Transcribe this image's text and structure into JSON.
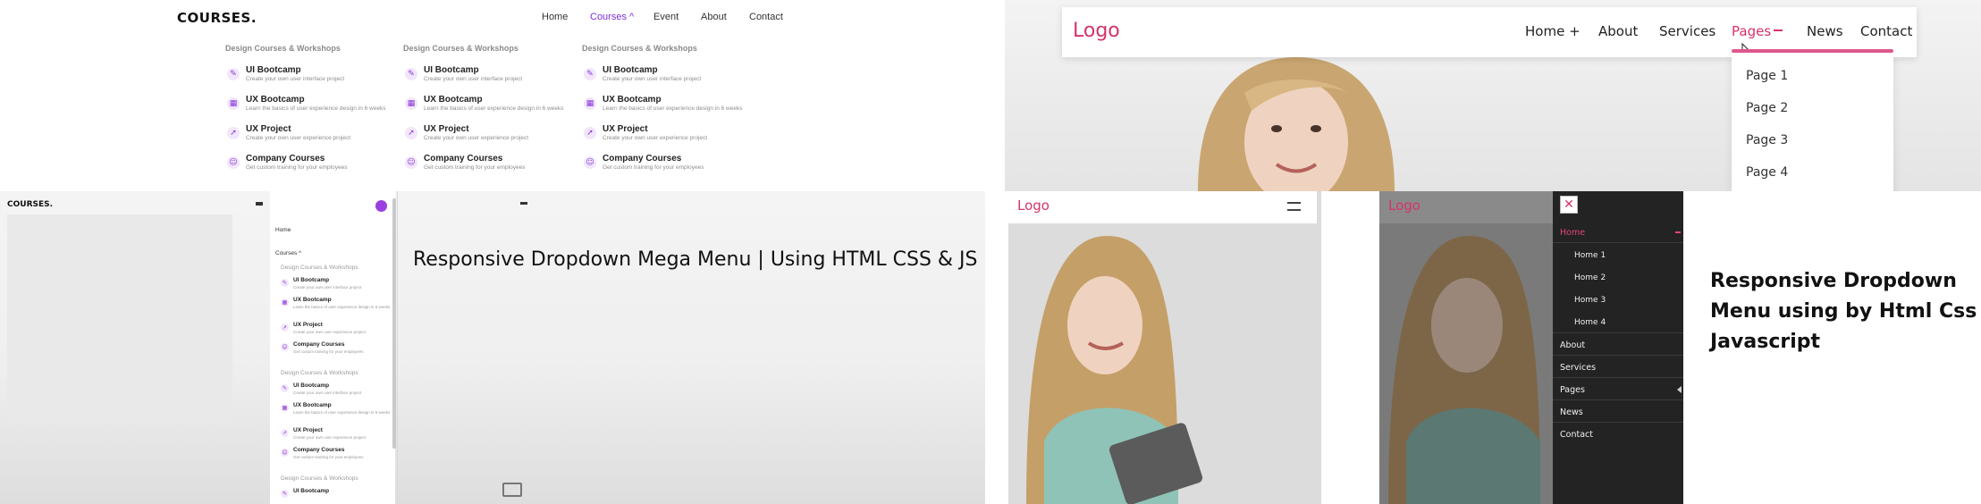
{
  "left_demo": {
    "brand": "COURSES.",
    "nav": [
      "Home",
      "Courses ^",
      "Event",
      "About",
      "Contact"
    ],
    "columns": [
      {
        "title": "Design Courses & Workshops",
        "items": [
          {
            "title": "UI Bootcamp",
            "sub": "Create your own user interface project"
          },
          {
            "title": "UX Bootcamp",
            "sub": "Learn the basics of user experience design in 6 weeks"
          },
          {
            "title": "UX Project",
            "sub": "Create your own user experience project"
          },
          {
            "title": "Company Courses",
            "sub": "Get custom training for your employees"
          }
        ]
      },
      {
        "title": "Design Courses & Workshops",
        "items": [
          {
            "title": "UI Bootcamp",
            "sub": "Create your own user interface project"
          },
          {
            "title": "UX Bootcamp",
            "sub": "Learn the basics of user experience design in 6 weeks"
          },
          {
            "title": "UX Project",
            "sub": "Create your own user experience project"
          },
          {
            "title": "Company Courses",
            "sub": "Get custom training for your employees"
          }
        ]
      },
      {
        "title": "Design Courses & Workshops",
        "items": [
          {
            "title": "UI Bootcamp",
            "sub": "Create your own user interface project"
          },
          {
            "title": "UX Bootcamp",
            "sub": "Learn the basics of user experience design in 6 weeks"
          },
          {
            "title": "UX Project",
            "sub": "Create your own user experience project"
          },
          {
            "title": "Company Courses",
            "sub": "Get custom training for your employees"
          }
        ]
      }
    ],
    "mobile": {
      "brand": "COURSES.",
      "home": "Home",
      "courses": "Courses ^",
      "section_title": "Design Courses & Workshops",
      "items": [
        "UI Bootcamp",
        "UX Bootcamp",
        "UX Project",
        "Company Courses"
      ],
      "item_subs": [
        "Create your own user interface project",
        "Learn the basics of user experience design in 6 weeks",
        "Create your own user experience project",
        "Get custom training for your employees"
      ]
    },
    "caption": "Responsive Dropdown Mega Menu | Using HTML CSS & JS"
  },
  "right_demo": {
    "logo": "Logo",
    "nav": [
      "Home +",
      "About",
      "Services",
      "Pages",
      "News",
      "Contact"
    ],
    "dropdown": [
      "Page 1",
      "Page 2",
      "Page 3",
      "Page 4"
    ],
    "side_menu": {
      "main": [
        "Home",
        "About",
        "Services",
        "Pages",
        "News",
        "Contact"
      ],
      "home_sub": [
        "Home 1",
        "Home 2",
        "Home 3",
        "Home 4"
      ]
    },
    "caption_lines": [
      "Responsive Dropdown",
      "Menu using by Html Css",
      "Javascript"
    ]
  },
  "colors": {
    "purple_accent": "#7b2fd6",
    "pink_accent": "#d6336c",
    "dark_menu": "#232323"
  },
  "icons": [
    "palette-icon",
    "layout-icon",
    "rocket-icon",
    "users-icon",
    "hamburger-icon",
    "close-icon",
    "plus-icon",
    "caret-icon"
  ]
}
